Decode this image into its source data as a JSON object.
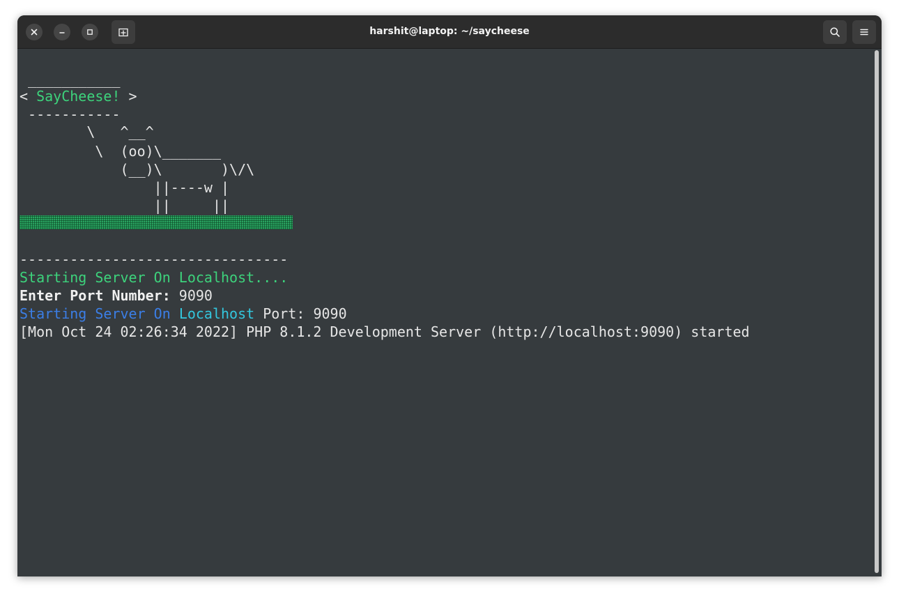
{
  "window": {
    "title": "harshit@laptop: ~/saycheese"
  },
  "titlebar": {
    "close_icon": "close-icon",
    "minimize_icon": "minimize-icon",
    "maximize_icon": "maximize-icon",
    "new_tab_icon": "new-tab-icon",
    "search_icon": "search-icon",
    "menu_icon": "hamburger-menu-icon"
  },
  "terminal": {
    "banner_top": " ___________",
    "banner_left": "< ",
    "banner_text": "SayCheese!",
    "banner_right": " >",
    "banner_bottom": " -----------",
    "cow_1": "        \\   ^__^",
    "cow_2": "         \\  (oo)\\_______",
    "cow_3": "            (__)\\       )\\/\\",
    "cow_4": "                ||----w |",
    "cow_5": "                ||     ||",
    "separator": "--------------------------------",
    "starting_local": "Starting Server On Localhost....",
    "port_prompt_label": "Enter Port Number:",
    "port_prompt_value": " 9090",
    "start_word_1": "Starting",
    "start_word_2": "Server",
    "start_word_3": "On",
    "start_word_4": "Localhost",
    "start_port_text": " Port: 9090",
    "php_log": "[Mon Oct 24 02:26:34 2022] PHP 8.1.2 Development Server (http://localhost:9090) started"
  },
  "colors": {
    "terminal_bg": "#363b3e",
    "titlebar_bg": "#2c2c2c",
    "green": "#3dd37c",
    "blue": "#3b7ee6",
    "cyan": "#33c7de",
    "text": "#e6e6e6"
  }
}
